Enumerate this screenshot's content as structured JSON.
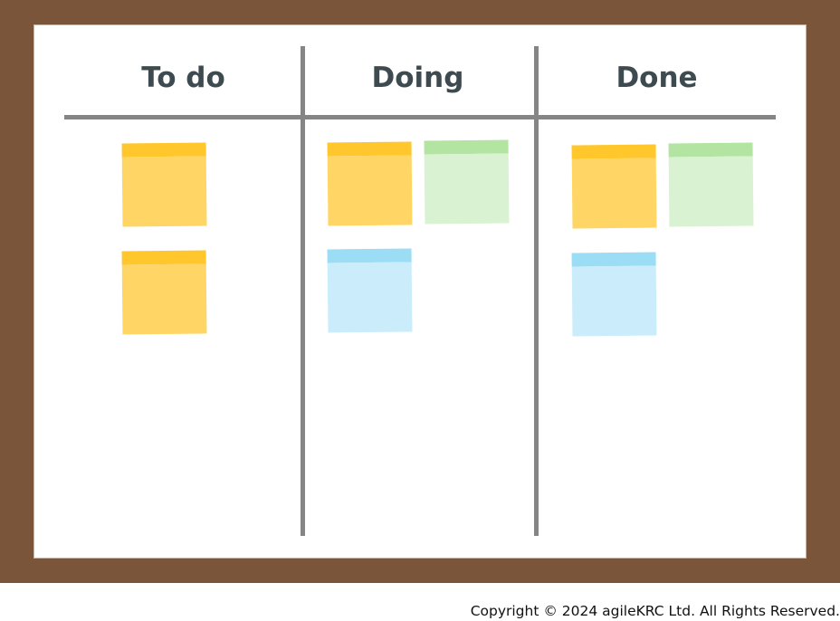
{
  "board": {
    "columns": [
      {
        "title": "To do"
      },
      {
        "title": "Doing"
      },
      {
        "title": "Done"
      }
    ],
    "notes": [
      {
        "column": "To do",
        "color": "yellow"
      },
      {
        "column": "To do",
        "color": "yellow"
      },
      {
        "column": "Doing",
        "color": "yellow"
      },
      {
        "column": "Doing",
        "color": "green"
      },
      {
        "column": "Doing",
        "color": "blue"
      },
      {
        "column": "Done",
        "color": "yellow"
      },
      {
        "column": "Done",
        "color": "green"
      },
      {
        "column": "Done",
        "color": "blue"
      }
    ]
  },
  "colors": {
    "frame": "#7a553a",
    "board": "#ffffff",
    "divider": "#858585",
    "title_text": "#3d4a4f",
    "note_yellow": {
      "tape": "#ffc72c",
      "body": "#ffd666"
    },
    "note_green": {
      "tape": "#b4e4a1",
      "body": "#d9f2d1"
    },
    "note_blue": {
      "tape": "#9addf5",
      "body": "#cbedfb"
    }
  },
  "footer": {
    "copyright": "Copyright © 2024 agileKRC Ltd. All Rights Reserved."
  }
}
